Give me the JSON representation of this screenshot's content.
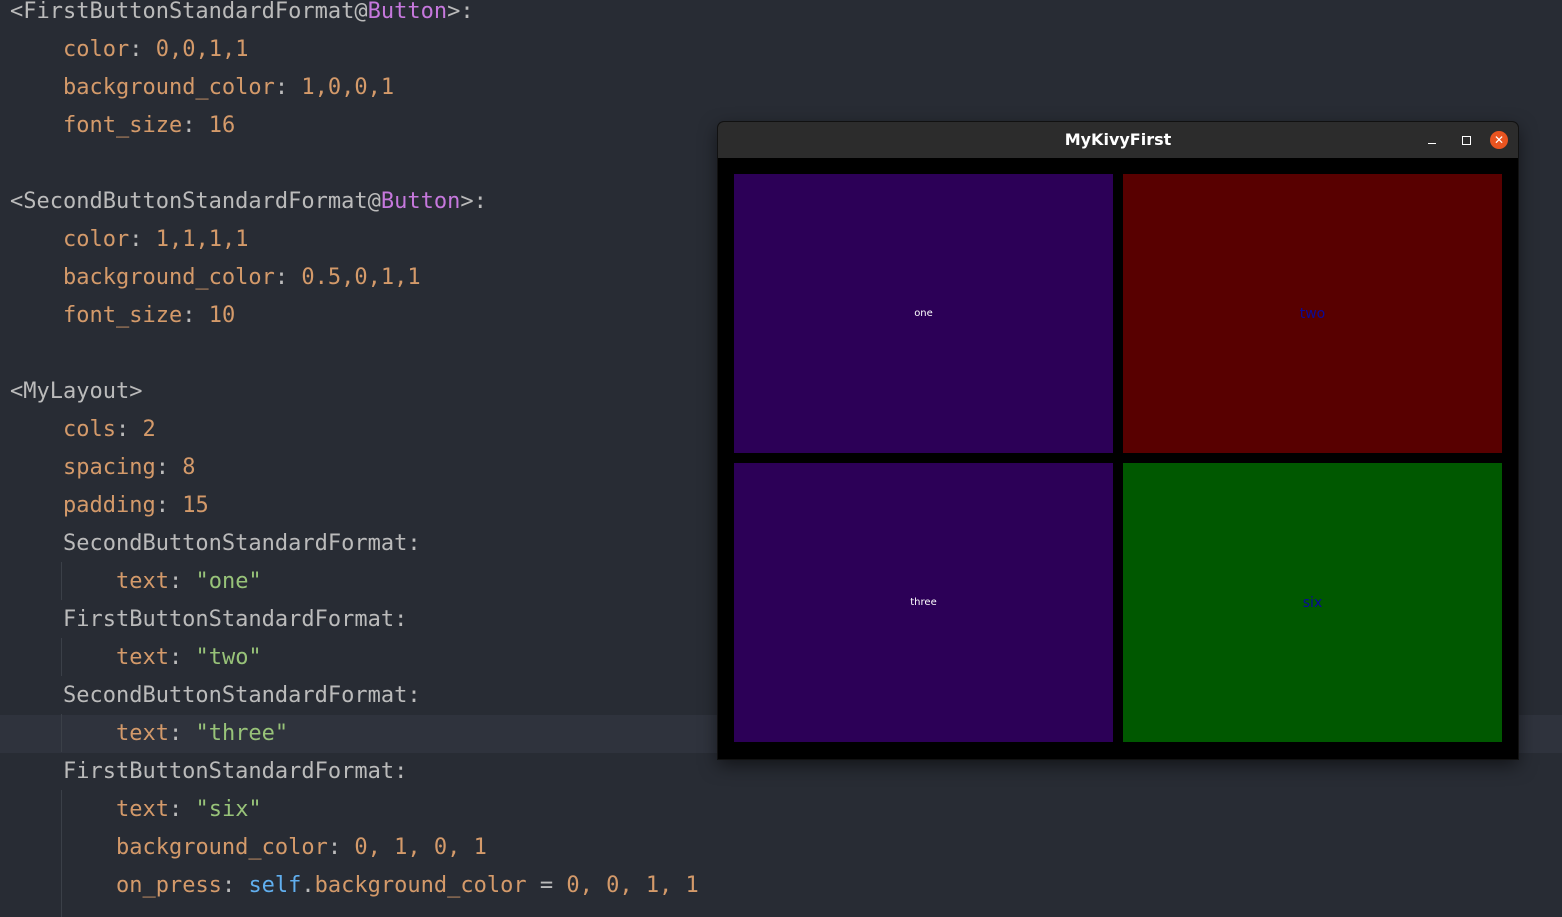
{
  "editor": {
    "lines": [
      {
        "tokens": [
          {
            "t": "<FirstButtonStandardFormat@",
            "c": "def"
          },
          {
            "t": "Button",
            "c": "fn"
          },
          {
            "t": ">:",
            "c": "def"
          }
        ]
      },
      {
        "tokens": [
          {
            "t": "    ",
            "c": "def"
          },
          {
            "t": "color",
            "c": "kw"
          },
          {
            "t": ": ",
            "c": "def"
          },
          {
            "t": "0,0,1,1",
            "c": "kw"
          }
        ]
      },
      {
        "tokens": [
          {
            "t": "    ",
            "c": "def"
          },
          {
            "t": "background_color",
            "c": "kw"
          },
          {
            "t": ": ",
            "c": "def"
          },
          {
            "t": "1,0,0,1",
            "c": "kw"
          }
        ]
      },
      {
        "tokens": [
          {
            "t": "    ",
            "c": "def"
          },
          {
            "t": "font_size",
            "c": "kw"
          },
          {
            "t": ": ",
            "c": "def"
          },
          {
            "t": "16",
            "c": "kw"
          }
        ]
      },
      {
        "tokens": []
      },
      {
        "tokens": [
          {
            "t": "<SecondButtonStandardFormat@",
            "c": "def"
          },
          {
            "t": "Button",
            "c": "fn"
          },
          {
            "t": ">:",
            "c": "def"
          }
        ]
      },
      {
        "tokens": [
          {
            "t": "    ",
            "c": "def"
          },
          {
            "t": "color",
            "c": "kw"
          },
          {
            "t": ": ",
            "c": "def"
          },
          {
            "t": "1,1,1,1",
            "c": "kw"
          }
        ]
      },
      {
        "tokens": [
          {
            "t": "    ",
            "c": "def"
          },
          {
            "t": "background_color",
            "c": "kw"
          },
          {
            "t": ": ",
            "c": "def"
          },
          {
            "t": "0.5,0,1,1",
            "c": "kw"
          }
        ]
      },
      {
        "tokens": [
          {
            "t": "    ",
            "c": "def"
          },
          {
            "t": "font_size",
            "c": "kw"
          },
          {
            "t": ": ",
            "c": "def"
          },
          {
            "t": "10",
            "c": "kw"
          }
        ]
      },
      {
        "tokens": []
      },
      {
        "tokens": [
          {
            "t": "<MyLayout>",
            "c": "def"
          }
        ]
      },
      {
        "tokens": [
          {
            "t": "    ",
            "c": "def"
          },
          {
            "t": "cols",
            "c": "kw"
          },
          {
            "t": ": ",
            "c": "def"
          },
          {
            "t": "2",
            "c": "kw"
          }
        ]
      },
      {
        "tokens": [
          {
            "t": "    ",
            "c": "def"
          },
          {
            "t": "spacing",
            "c": "kw"
          },
          {
            "t": ": ",
            "c": "def"
          },
          {
            "t": "8",
            "c": "kw"
          }
        ]
      },
      {
        "tokens": [
          {
            "t": "    ",
            "c": "def"
          },
          {
            "t": "padding",
            "c": "kw"
          },
          {
            "t": ": ",
            "c": "def"
          },
          {
            "t": "15",
            "c": "kw"
          }
        ]
      },
      {
        "tokens": [
          {
            "t": "    SecondButtonStandardFormat:",
            "c": "def"
          }
        ]
      },
      {
        "tokens": [
          {
            "t": "        ",
            "c": "def"
          },
          {
            "t": "text",
            "c": "kw"
          },
          {
            "t": ": ",
            "c": "def"
          },
          {
            "t": "\"one\"",
            "c": "str"
          }
        ]
      },
      {
        "tokens": [
          {
            "t": "    FirstButtonStandardFormat:",
            "c": "def"
          }
        ]
      },
      {
        "tokens": [
          {
            "t": "        ",
            "c": "def"
          },
          {
            "t": "text",
            "c": "kw"
          },
          {
            "t": ": ",
            "c": "def"
          },
          {
            "t": "\"two\"",
            "c": "str"
          }
        ]
      },
      {
        "tokens": [
          {
            "t": "    SecondButtonStandardFormat:",
            "c": "def"
          }
        ]
      },
      {
        "tokens": [
          {
            "t": "        ",
            "c": "def"
          },
          {
            "t": "text",
            "c": "kw"
          },
          {
            "t": ": ",
            "c": "def"
          },
          {
            "t": "\"three\"",
            "c": "str"
          }
        ]
      },
      {
        "tokens": [
          {
            "t": "    FirstButtonStandardFormat:",
            "c": "def"
          }
        ]
      },
      {
        "tokens": [
          {
            "t": "        ",
            "c": "def"
          },
          {
            "t": "text",
            "c": "kw"
          },
          {
            "t": ": ",
            "c": "def"
          },
          {
            "t": "\"six\"",
            "c": "str"
          }
        ]
      },
      {
        "tokens": [
          {
            "t": "        ",
            "c": "def"
          },
          {
            "t": "background_color",
            "c": "kw"
          },
          {
            "t": ": ",
            "c": "def"
          },
          {
            "t": "0, 1, 0, 1",
            "c": "kw"
          }
        ]
      },
      {
        "tokens": [
          {
            "t": "        ",
            "c": "def"
          },
          {
            "t": "on_press",
            "c": "kw"
          },
          {
            "t": ": ",
            "c": "def"
          },
          {
            "t": "self",
            "c": "slf"
          },
          {
            "t": ".",
            "c": "def"
          },
          {
            "t": "background_color",
            "c": "kw"
          },
          {
            "t": " = ",
            "c": "def"
          },
          {
            "t": "0, 0, 1, 1",
            "c": "kw"
          }
        ]
      }
    ]
  },
  "kivy_window": {
    "title": "MyKivyFirst",
    "minimize_glyph": "",
    "close_glyph": "✕",
    "buttons": [
      {
        "label": "one",
        "color": "#2c0057"
      },
      {
        "label": "two",
        "color": "#580000"
      },
      {
        "label": "three",
        "color": "#2c0057"
      },
      {
        "label": "six",
        "color": "#005800"
      }
    ]
  },
  "colors": {
    "editor_bg": "#282c34",
    "current_line": "#2f333d",
    "close_button": "#e95420"
  }
}
